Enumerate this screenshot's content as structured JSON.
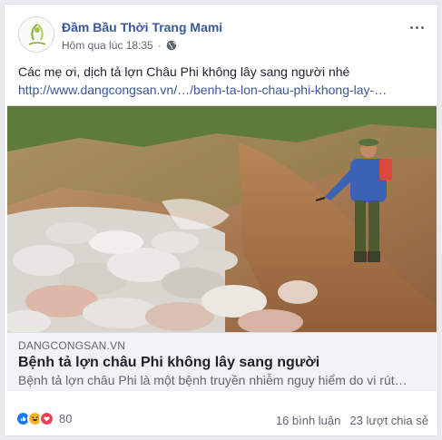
{
  "post": {
    "page_name": "Đầm Bầu Thời Trang Mami",
    "timestamp": "Hôm qua lúc 18:35",
    "privacy_icon": "globe-icon",
    "more_icon": "more-options-icon",
    "text": "Các mẹ ơi, dịch tả lợn Châu Phi không lây sang người nhé",
    "link": "http://www.dangcongsan.vn/…/benh-ta-lon-chau-phi-khong-lay-…"
  },
  "link_preview": {
    "domain": "DANGCONGSAN.VN",
    "title": "Bệnh tả lợn châu Phi không lây sang người",
    "description": "Bệnh tả lợn châu Phi là một bệnh truyền nhiễm nguy hiểm do vi rút…"
  },
  "engagement": {
    "reaction_icons": [
      "like-icon",
      "haha-icon",
      "love-icon"
    ],
    "reaction_count": "80",
    "comments": "16 bình luận",
    "shares": "23 lượt chia sẻ"
  },
  "colors": {
    "link_blue": "#385898",
    "like": "#1877f2",
    "haha": "#f7b125",
    "love": "#f33e58"
  }
}
